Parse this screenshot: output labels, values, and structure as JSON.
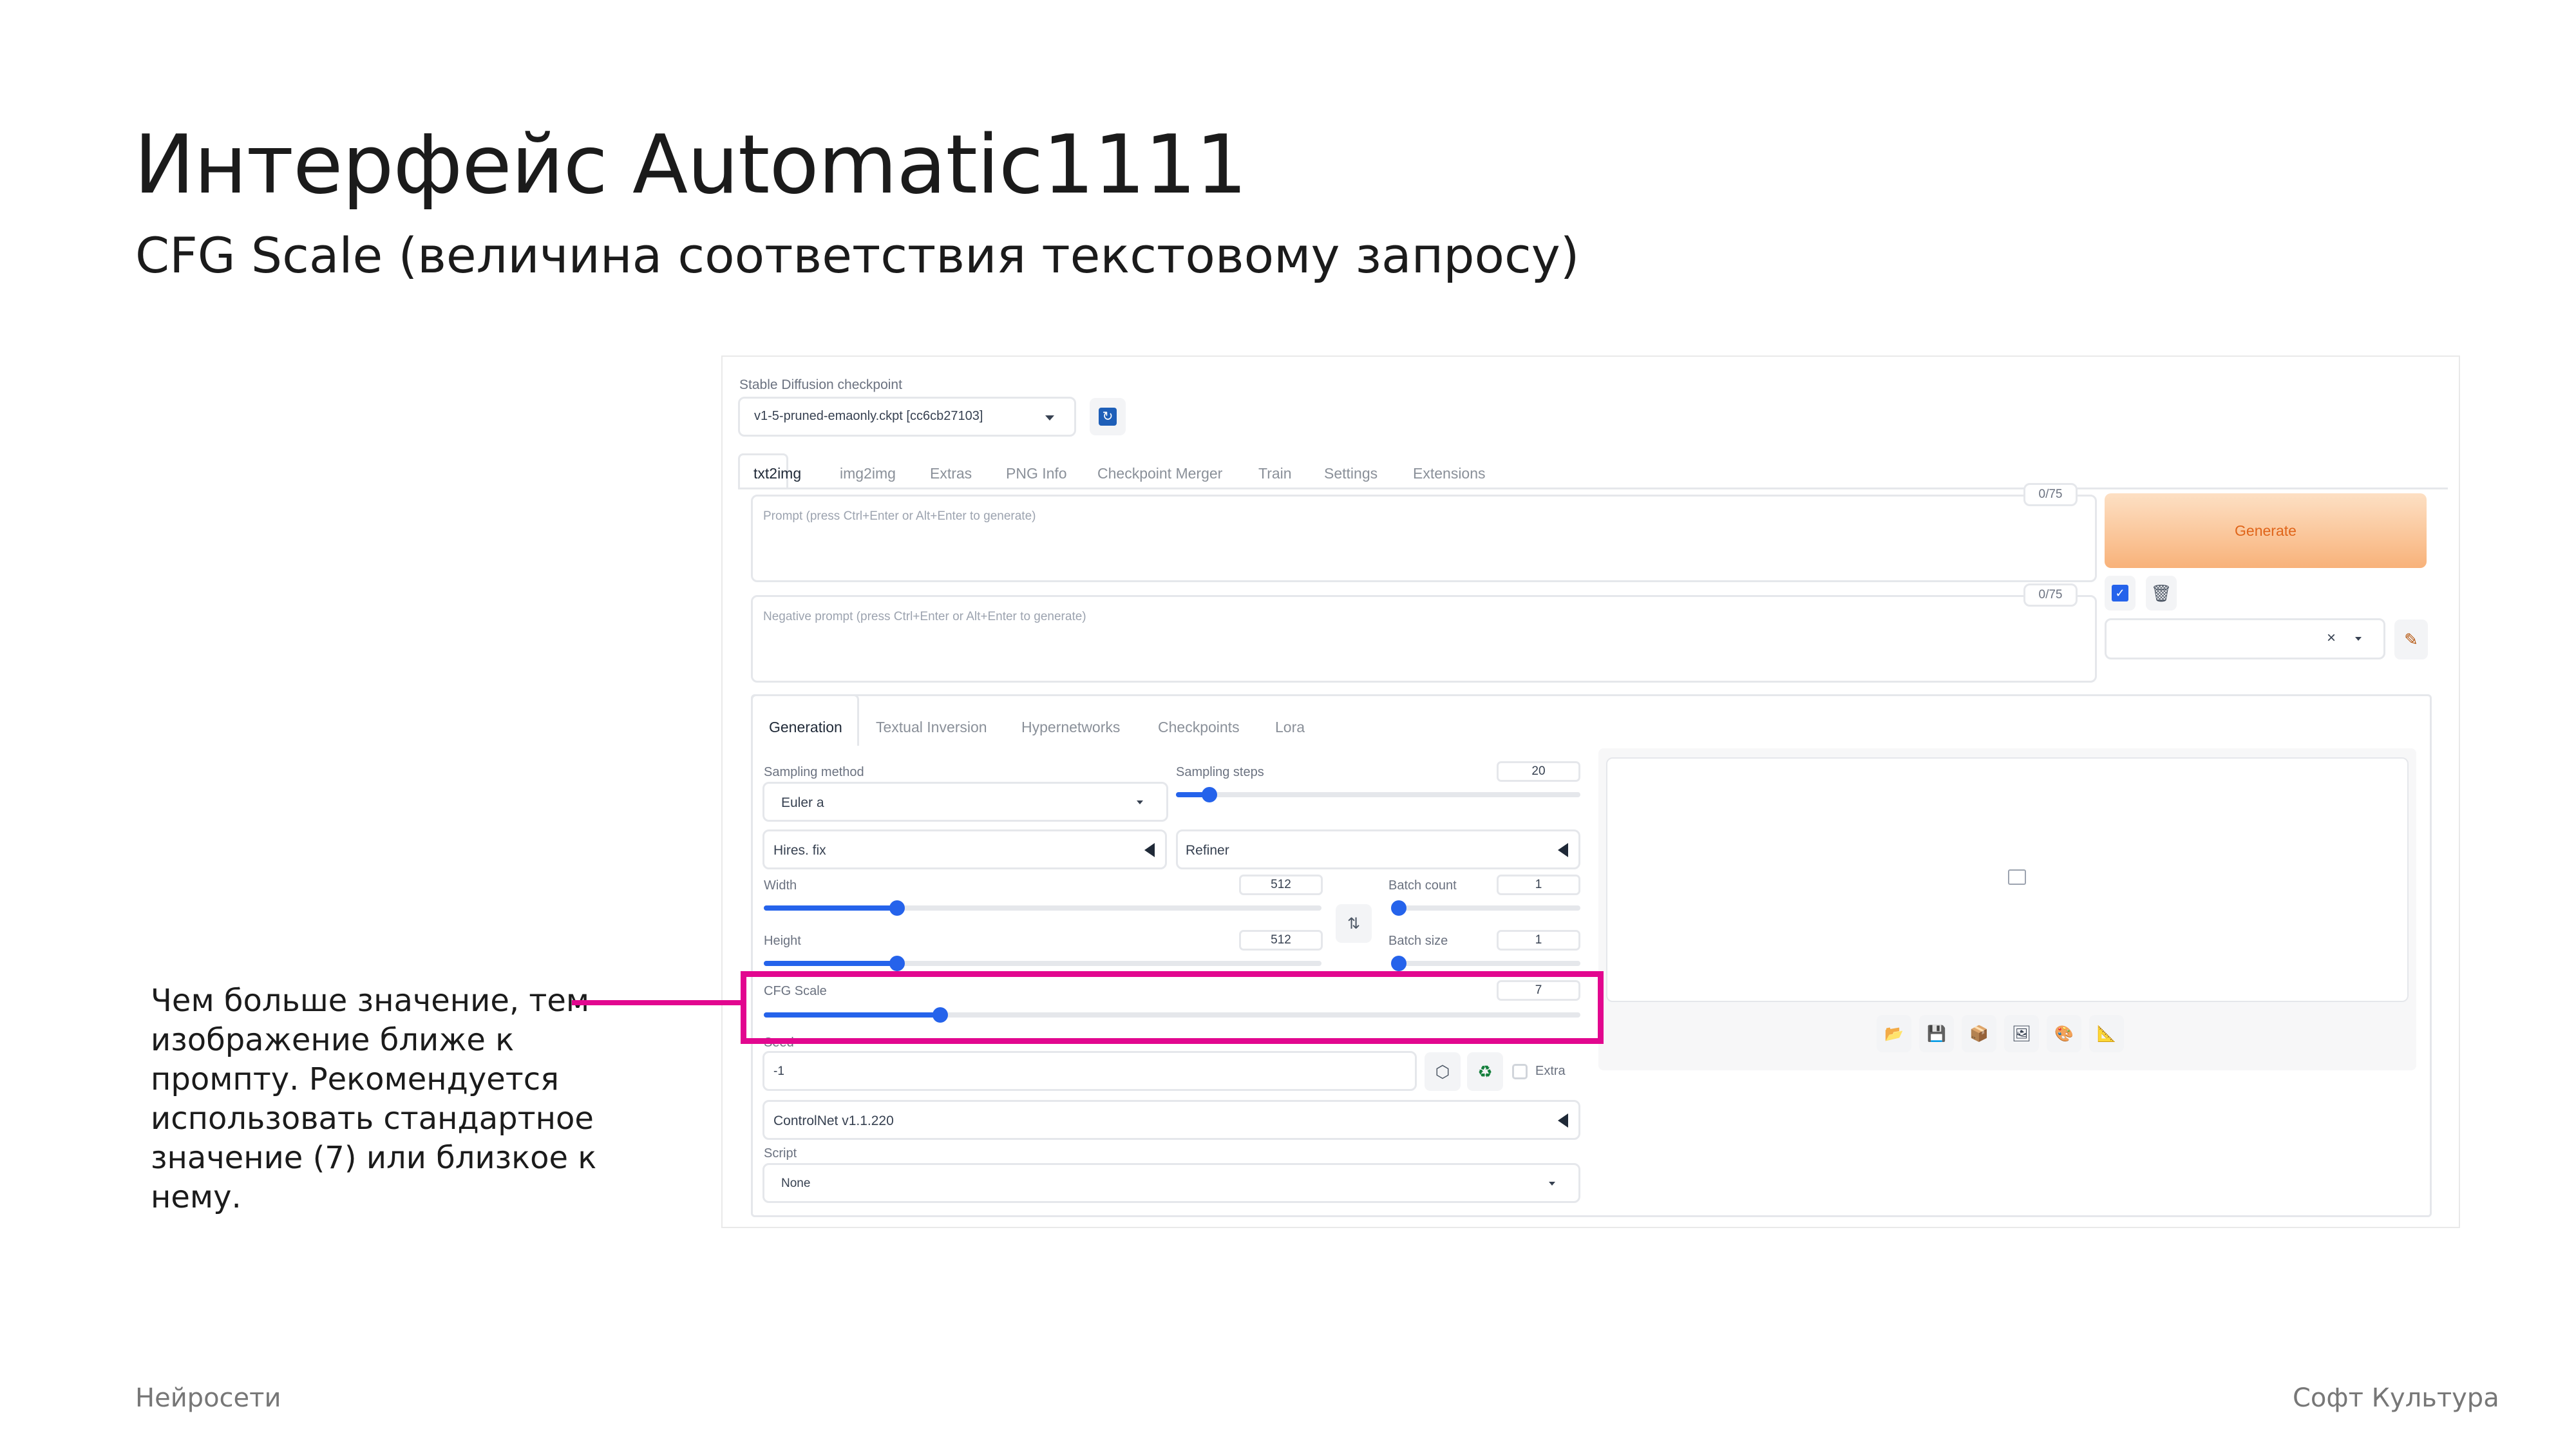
{
  "slide": {
    "title": "Интерфейс Automatic1111",
    "subtitle": "CFG Scale (величина соответствия текстовому запросу)",
    "note": "Чем больше значение, тем изображение ближе к промпту. Рекомендуется использовать стандартное значение (7) или близкое к нему.",
    "footer_left": "Нейросети",
    "footer_right": "Софт Культура",
    "highlight_color": "#e2078f"
  },
  "ui": {
    "checkpoint_label": "Stable Diffusion checkpoint",
    "checkpoint_value": "v1-5-pruned-emaonly.ckpt [cc6cb27103]",
    "main_tabs": [
      "txt2img",
      "img2img",
      "Extras",
      "PNG Info",
      "Checkpoint Merger",
      "Train",
      "Settings",
      "Extensions"
    ],
    "prompt_placeholder": "Prompt (press Ctrl+Enter or Alt+Enter to generate)",
    "prompt_counter": "0/75",
    "neg_placeholder": "Negative prompt (press Ctrl+Enter or Alt+Enter to generate)",
    "neg_counter": "0/75",
    "generate_label": "Generate",
    "style_clear": "×",
    "sub_tabs": [
      "Generation",
      "Textual Inversion",
      "Hypernetworks",
      "Checkpoints",
      "Lora"
    ],
    "sampling_method_label": "Sampling method",
    "sampling_method_value": "Euler a",
    "sampling_steps_label": "Sampling steps",
    "sampling_steps_value": "20",
    "hires_label": "Hires. fix",
    "refiner_label": "Refiner",
    "width_label": "Width",
    "width_value": "512",
    "height_label": "Height",
    "height_value": "512",
    "batch_count_label": "Batch count",
    "batch_count_value": "1",
    "batch_size_label": "Batch size",
    "batch_size_value": "1",
    "cfg_label": "CFG Scale",
    "cfg_value": "7",
    "seed_label": "Seed",
    "seed_value": "-1",
    "extra_label": "Extra",
    "controlnet_label": "ControlNet v1.1.220",
    "script_label": "Script",
    "script_value": "None",
    "accent_color": "#2563eb",
    "generate_color": "#f8b27a",
    "sliders": {
      "sampling_steps": 0.07,
      "width": 0.23,
      "height": 0.23,
      "batch_count": 0.0,
      "batch_size": 0.0,
      "cfg_scale": 0.21
    }
  }
}
